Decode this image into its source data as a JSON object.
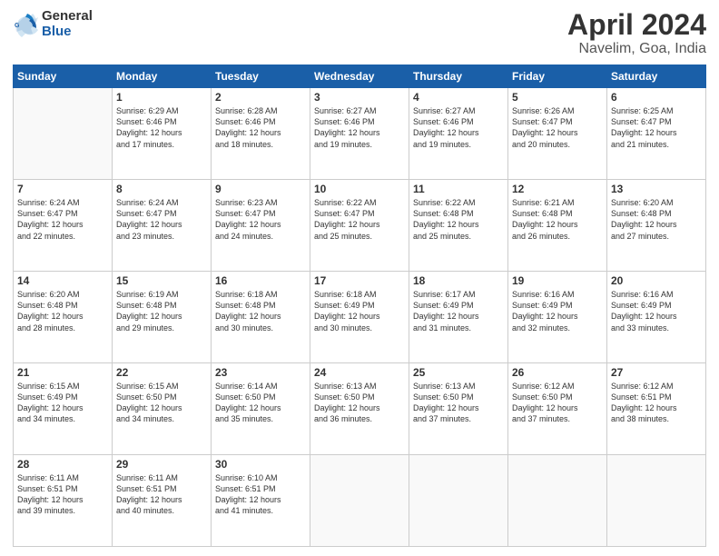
{
  "logo": {
    "general": "General",
    "blue": "Blue"
  },
  "header": {
    "title": "April 2024",
    "location": "Navelim, Goa, India"
  },
  "weekdays": [
    "Sunday",
    "Monday",
    "Tuesday",
    "Wednesday",
    "Thursday",
    "Friday",
    "Saturday"
  ],
  "weeks": [
    [
      {
        "day": "",
        "empty": true
      },
      {
        "day": "1",
        "sunrise": "6:29 AM",
        "sunset": "6:46 PM",
        "daylight": "12 hours and 17 minutes."
      },
      {
        "day": "2",
        "sunrise": "6:28 AM",
        "sunset": "6:46 PM",
        "daylight": "12 hours and 18 minutes."
      },
      {
        "day": "3",
        "sunrise": "6:27 AM",
        "sunset": "6:46 PM",
        "daylight": "12 hours and 19 minutes."
      },
      {
        "day": "4",
        "sunrise": "6:27 AM",
        "sunset": "6:46 PM",
        "daylight": "12 hours and 19 minutes."
      },
      {
        "day": "5",
        "sunrise": "6:26 AM",
        "sunset": "6:47 PM",
        "daylight": "12 hours and 20 minutes."
      },
      {
        "day": "6",
        "sunrise": "6:25 AM",
        "sunset": "6:47 PM",
        "daylight": "12 hours and 21 minutes."
      }
    ],
    [
      {
        "day": "7",
        "sunrise": "6:24 AM",
        "sunset": "6:47 PM",
        "daylight": "12 hours and 22 minutes."
      },
      {
        "day": "8",
        "sunrise": "6:24 AM",
        "sunset": "6:47 PM",
        "daylight": "12 hours and 23 minutes."
      },
      {
        "day": "9",
        "sunrise": "6:23 AM",
        "sunset": "6:47 PM",
        "daylight": "12 hours and 24 minutes."
      },
      {
        "day": "10",
        "sunrise": "6:22 AM",
        "sunset": "6:47 PM",
        "daylight": "12 hours and 25 minutes."
      },
      {
        "day": "11",
        "sunrise": "6:22 AM",
        "sunset": "6:48 PM",
        "daylight": "12 hours and 25 minutes."
      },
      {
        "day": "12",
        "sunrise": "6:21 AM",
        "sunset": "6:48 PM",
        "daylight": "12 hours and 26 minutes."
      },
      {
        "day": "13",
        "sunrise": "6:20 AM",
        "sunset": "6:48 PM",
        "daylight": "12 hours and 27 minutes."
      }
    ],
    [
      {
        "day": "14",
        "sunrise": "6:20 AM",
        "sunset": "6:48 PM",
        "daylight": "12 hours and 28 minutes."
      },
      {
        "day": "15",
        "sunrise": "6:19 AM",
        "sunset": "6:48 PM",
        "daylight": "12 hours and 29 minutes."
      },
      {
        "day": "16",
        "sunrise": "6:18 AM",
        "sunset": "6:48 PM",
        "daylight": "12 hours and 30 minutes."
      },
      {
        "day": "17",
        "sunrise": "6:18 AM",
        "sunset": "6:49 PM",
        "daylight": "12 hours and 30 minutes."
      },
      {
        "day": "18",
        "sunrise": "6:17 AM",
        "sunset": "6:49 PM",
        "daylight": "12 hours and 31 minutes."
      },
      {
        "day": "19",
        "sunrise": "6:16 AM",
        "sunset": "6:49 PM",
        "daylight": "12 hours and 32 minutes."
      },
      {
        "day": "20",
        "sunrise": "6:16 AM",
        "sunset": "6:49 PM",
        "daylight": "12 hours and 33 minutes."
      }
    ],
    [
      {
        "day": "21",
        "sunrise": "6:15 AM",
        "sunset": "6:49 PM",
        "daylight": "12 hours and 34 minutes."
      },
      {
        "day": "22",
        "sunrise": "6:15 AM",
        "sunset": "6:50 PM",
        "daylight": "12 hours and 34 minutes."
      },
      {
        "day": "23",
        "sunrise": "6:14 AM",
        "sunset": "6:50 PM",
        "daylight": "12 hours and 35 minutes."
      },
      {
        "day": "24",
        "sunrise": "6:13 AM",
        "sunset": "6:50 PM",
        "daylight": "12 hours and 36 minutes."
      },
      {
        "day": "25",
        "sunrise": "6:13 AM",
        "sunset": "6:50 PM",
        "daylight": "12 hours and 37 minutes."
      },
      {
        "day": "26",
        "sunrise": "6:12 AM",
        "sunset": "6:50 PM",
        "daylight": "12 hours and 37 minutes."
      },
      {
        "day": "27",
        "sunrise": "6:12 AM",
        "sunset": "6:51 PM",
        "daylight": "12 hours and 38 minutes."
      }
    ],
    [
      {
        "day": "28",
        "sunrise": "6:11 AM",
        "sunset": "6:51 PM",
        "daylight": "12 hours and 39 minutes."
      },
      {
        "day": "29",
        "sunrise": "6:11 AM",
        "sunset": "6:51 PM",
        "daylight": "12 hours and 40 minutes."
      },
      {
        "day": "30",
        "sunrise": "6:10 AM",
        "sunset": "6:51 PM",
        "daylight": "12 hours and 41 minutes."
      },
      {
        "day": "",
        "empty": true
      },
      {
        "day": "",
        "empty": true
      },
      {
        "day": "",
        "empty": true
      },
      {
        "day": "",
        "empty": true
      }
    ]
  ],
  "labels": {
    "sunrise": "Sunrise:",
    "sunset": "Sunset:",
    "daylight": "Daylight:"
  }
}
